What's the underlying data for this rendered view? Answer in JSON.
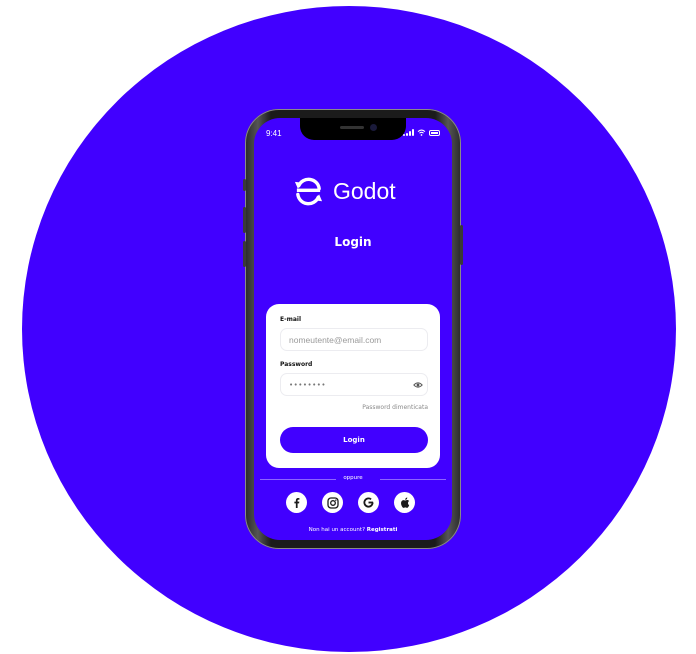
{
  "status": {
    "time": "9:41"
  },
  "brand": {
    "name": "Godot"
  },
  "screen_title": "Login",
  "form": {
    "email_label": "E-mail",
    "email_placeholder": "nomeutente@email.com",
    "password_label": "Password",
    "password_value": "••••••••",
    "forgot_link": "Password dimenticata",
    "login_button": "Login"
  },
  "divider_text": "oppure",
  "social_icons": [
    "facebook-icon",
    "instagram-icon",
    "google-icon",
    "apple-icon"
  ],
  "signup": {
    "prompt": "Non hai un account?",
    "link": "Registrati"
  },
  "colors": {
    "brand": "#4100ff",
    "card": "#ffffff"
  }
}
